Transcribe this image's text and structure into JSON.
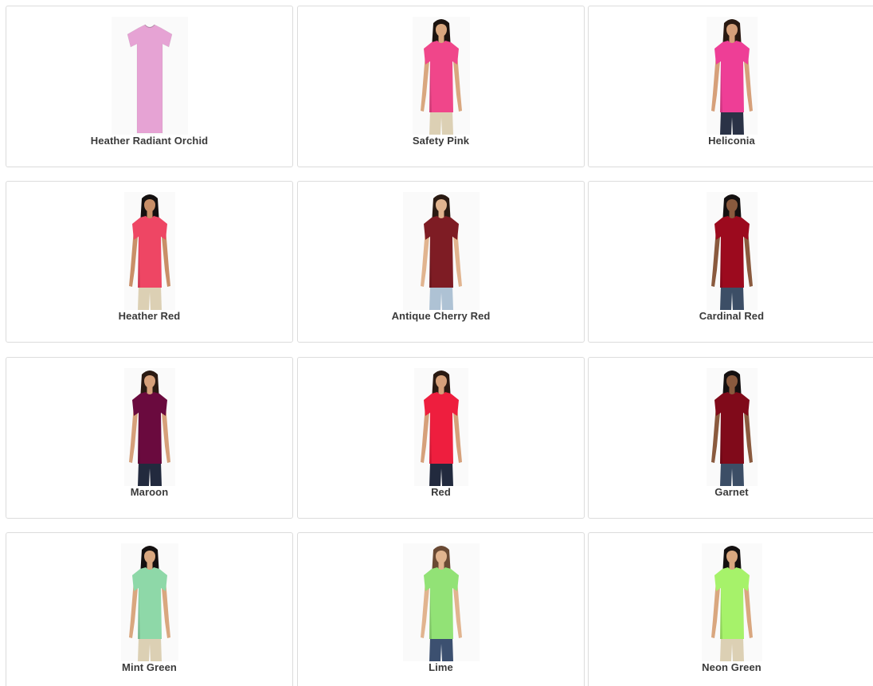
{
  "swatches": [
    {
      "name": "Heather Radiant Orchid",
      "shirt_color": "#e6a3d4",
      "model": false,
      "skin": "#d9a77f",
      "hair": "#1c1410",
      "pants": "#d8c8aa"
    },
    {
      "name": "Safety Pink",
      "shirt_color": "#f0468a",
      "model": true,
      "skin": "#d9a77f",
      "hair": "#1c1410",
      "pants": "#dcd0b4"
    },
    {
      "name": "Heliconia",
      "shirt_color": "#ee3e96",
      "model": true,
      "skin": "#d6a07a",
      "hair": "#2a1a12",
      "pants": "#2a3246"
    },
    {
      "name": "Heather Red",
      "shirt_color": "#ee4664",
      "model": true,
      "skin": "#c98f68",
      "hair": "#141010",
      "pants": "#dcd0b4"
    },
    {
      "name": "Antique Cherry Red",
      "shirt_color": "#7e1c24",
      "model": true,
      "skin": "#e1b48f",
      "hair": "#2a1a12",
      "pants": "#aec2d4"
    },
    {
      "name": "Cardinal Red",
      "shirt_color": "#9c0a1e",
      "model": true,
      "skin": "#8a5a3e",
      "hair": "#141010",
      "pants": "#3c4e66"
    },
    {
      "name": "Maroon",
      "shirt_color": "#6a0a3e",
      "model": true,
      "skin": "#d6a07a",
      "hair": "#2a1a12",
      "pants": "#222a3e"
    },
    {
      "name": "Red",
      "shirt_color": "#ee1e3e",
      "model": true,
      "skin": "#d6a07a",
      "hair": "#2a1a12",
      "pants": "#222a3e"
    },
    {
      "name": "Garnet",
      "shirt_color": "#800a1a",
      "model": true,
      "skin": "#8a5a3e",
      "hair": "#141010",
      "pants": "#3c4e66"
    },
    {
      "name": "Mint Green",
      "shirt_color": "#8ed8a8",
      "model": true,
      "skin": "#d9a77f",
      "hair": "#141010",
      "pants": "#dcd0b4"
    },
    {
      "name": "Lime",
      "shirt_color": "#92e276",
      "model": true,
      "skin": "#e1b48f",
      "hair": "#6a4a34",
      "pants": "#3c5070"
    },
    {
      "name": "Neon Green",
      "shirt_color": "#a6f26a",
      "model": true,
      "skin": "#d9a77f",
      "hair": "#141010",
      "pants": "#dcd0b4"
    }
  ]
}
